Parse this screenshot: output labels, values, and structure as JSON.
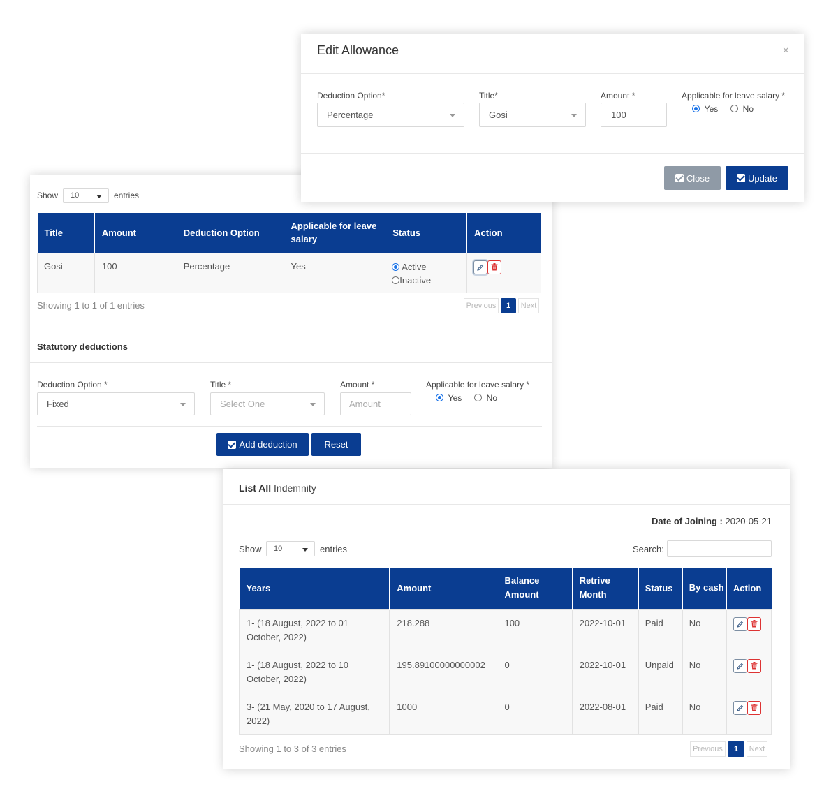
{
  "modal": {
    "title": "Edit Allowance",
    "close_symbol": "×",
    "fields": {
      "deduction_option_label": "Deduction Option*",
      "deduction_option_value": "Percentage",
      "title_label": "Title*",
      "title_value": "Gosi",
      "amount_label": "Amount *",
      "amount_value": "100",
      "leave_salary_label": "Applicable for leave salary *",
      "yes_label": "Yes",
      "no_label": "No"
    },
    "close_button": "Close",
    "update_button": "Update"
  },
  "deductions_panel": {
    "show_label": "Show",
    "show_value": "10",
    "entries_label": "entries",
    "table": {
      "headers": [
        "Title",
        "Amount",
        "Deduction Option",
        "Applicable for leave salary",
        "Status",
        "Action"
      ],
      "rows": [
        {
          "title": "Gosi",
          "amount": "100",
          "option": "Percentage",
          "leave": "Yes",
          "status_active": "Active",
          "status_inactive": "Inactive"
        }
      ]
    },
    "showing": "Showing 1 to 1 of 1 entries",
    "pager": {
      "prev": "Previous",
      "current": "1",
      "next": "Next"
    },
    "section_title": "Statutory deductions",
    "form": {
      "deduction_option_label": "Deduction Option *",
      "deduction_option_value": "Fixed",
      "title_label": "Title *",
      "title_placeholder": "Select One",
      "amount_label": "Amount *",
      "amount_placeholder": "Amount",
      "leave_salary_label": "Applicable for leave salary *",
      "yes_label": "Yes",
      "no_label": "No"
    },
    "add_button": "Add deduction",
    "reset_button": "Reset"
  },
  "indemnity": {
    "title_bold": "List All",
    "title_rest": "Indemnity",
    "doj_label": "Date of Joining :",
    "doj_value": "2020-05-21",
    "show_label": "Show",
    "show_value": "10",
    "entries_label": "entries",
    "search_label": "Search:",
    "headers": [
      "Years",
      "Amount",
      "Balance Amount",
      "Retrive Month",
      "Status",
      "By cash",
      "Action"
    ],
    "rows": [
      {
        "years": "1- (18 August, 2022 to 01 October, 2022)",
        "amount": "218.288",
        "balance": "100",
        "month": "2022-10-01",
        "status": "Paid",
        "cash": "No"
      },
      {
        "years": "1- (18 August, 2022 to 10 October, 2022)",
        "amount": "195.89100000000002",
        "balance": "0",
        "month": "2022-10-01",
        "status": "Unpaid",
        "cash": "No"
      },
      {
        "years": "3- (21 May, 2020 to 17 August, 2022)",
        "amount": "1000",
        "balance": "0",
        "month": "2022-08-01",
        "status": "Paid",
        "cash": "No"
      }
    ],
    "showing": "Showing 1 to 3 of 3 entries",
    "pager": {
      "prev": "Previous",
      "current": "1",
      "next": "Next"
    }
  },
  "colors": {
    "primary": "#0a3d91",
    "danger": "#dd3333",
    "muted": "#8f9aa6"
  }
}
